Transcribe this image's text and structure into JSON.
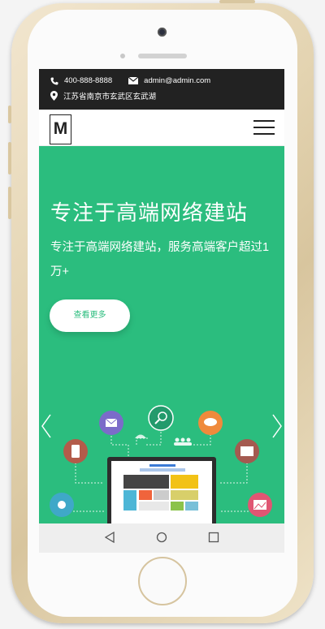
{
  "topbar": {
    "phone": "400-888-8888",
    "email": "admin@admin.com",
    "address": "江苏省南京市玄武区玄武湖"
  },
  "navbar": {
    "logo_letter": "M",
    "menu_icon": "hamburger-menu-icon"
  },
  "hero": {
    "title": "专注于高端网络建站",
    "subtitle": "专注于高端网络建站，服务高端客户超过1万+",
    "cta_label": "查看更多",
    "background_color": "#2bbd7e"
  },
  "system_nav": {
    "back_icon": "back-triangle-icon",
    "home_icon": "home-circle-icon",
    "recents_icon": "recents-square-icon"
  }
}
